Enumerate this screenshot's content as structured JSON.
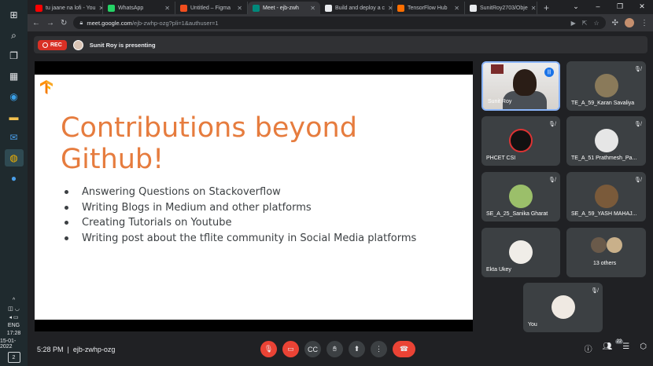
{
  "taskbar": {
    "time": "17:28",
    "date": "15-01-2022",
    "lang": "ENG",
    "notifications": "2",
    "pinned": [
      "windows-icon",
      "search-icon",
      "task-view-icon",
      "widgets-icon",
      "edge-icon",
      "files-icon",
      "mail-icon",
      "chrome-icon",
      "app-icon"
    ]
  },
  "browser": {
    "tabs": [
      {
        "title": "tu jaane na lofi - You",
        "color": "#ff0000"
      },
      {
        "title": "WhatsApp",
        "color": "#25d366"
      },
      {
        "title": "Untitled – Figma",
        "color": "#f24e1e"
      },
      {
        "title": "Meet - ejb-zwh",
        "color": "#00897b",
        "active": true
      },
      {
        "title": "Build and deploy a c",
        "color": "#e8eaed"
      },
      {
        "title": "TensorFlow Hub",
        "color": "#ff6f00"
      },
      {
        "title": "SunitRoy2703/Obje",
        "color": "#e8eaed"
      }
    ],
    "url_host": "meet.google.com",
    "url_path": "/ejb-zwhp-ozg?pli=1&authuser=1"
  },
  "meet": {
    "rec_label": "REC",
    "presenting_text": "Sunit Roy is presenting",
    "slide": {
      "title": "Contributions beyond Github!",
      "bullets": [
        "Answering Questions on Stackoverflow",
        "Writing Blogs in Medium and other platforms",
        "Creating Tutorials on Youtube",
        "Writing post about the tflite community in Social Media platforms"
      ],
      "accent": "#e67c3e"
    },
    "participants": [
      {
        "name": "Sunit Roy",
        "speaking": true
      },
      {
        "name": "TE_A_59_Karan Savaliya"
      },
      {
        "name": "PHCET CSI"
      },
      {
        "name": "TE_A_51 Prathmesh_Pa..."
      },
      {
        "name": "SE_A_25_Sanika Gharat"
      },
      {
        "name": "SE_A_59_YASH MAHAJ..."
      },
      {
        "name": "Ekta Ukey"
      },
      {
        "name": "13 others"
      },
      {
        "name": "You"
      }
    ],
    "bottom": {
      "time": "5:28 PM",
      "meeting_code": "ejb-zwhp-ozg",
      "people_count": "22"
    }
  }
}
